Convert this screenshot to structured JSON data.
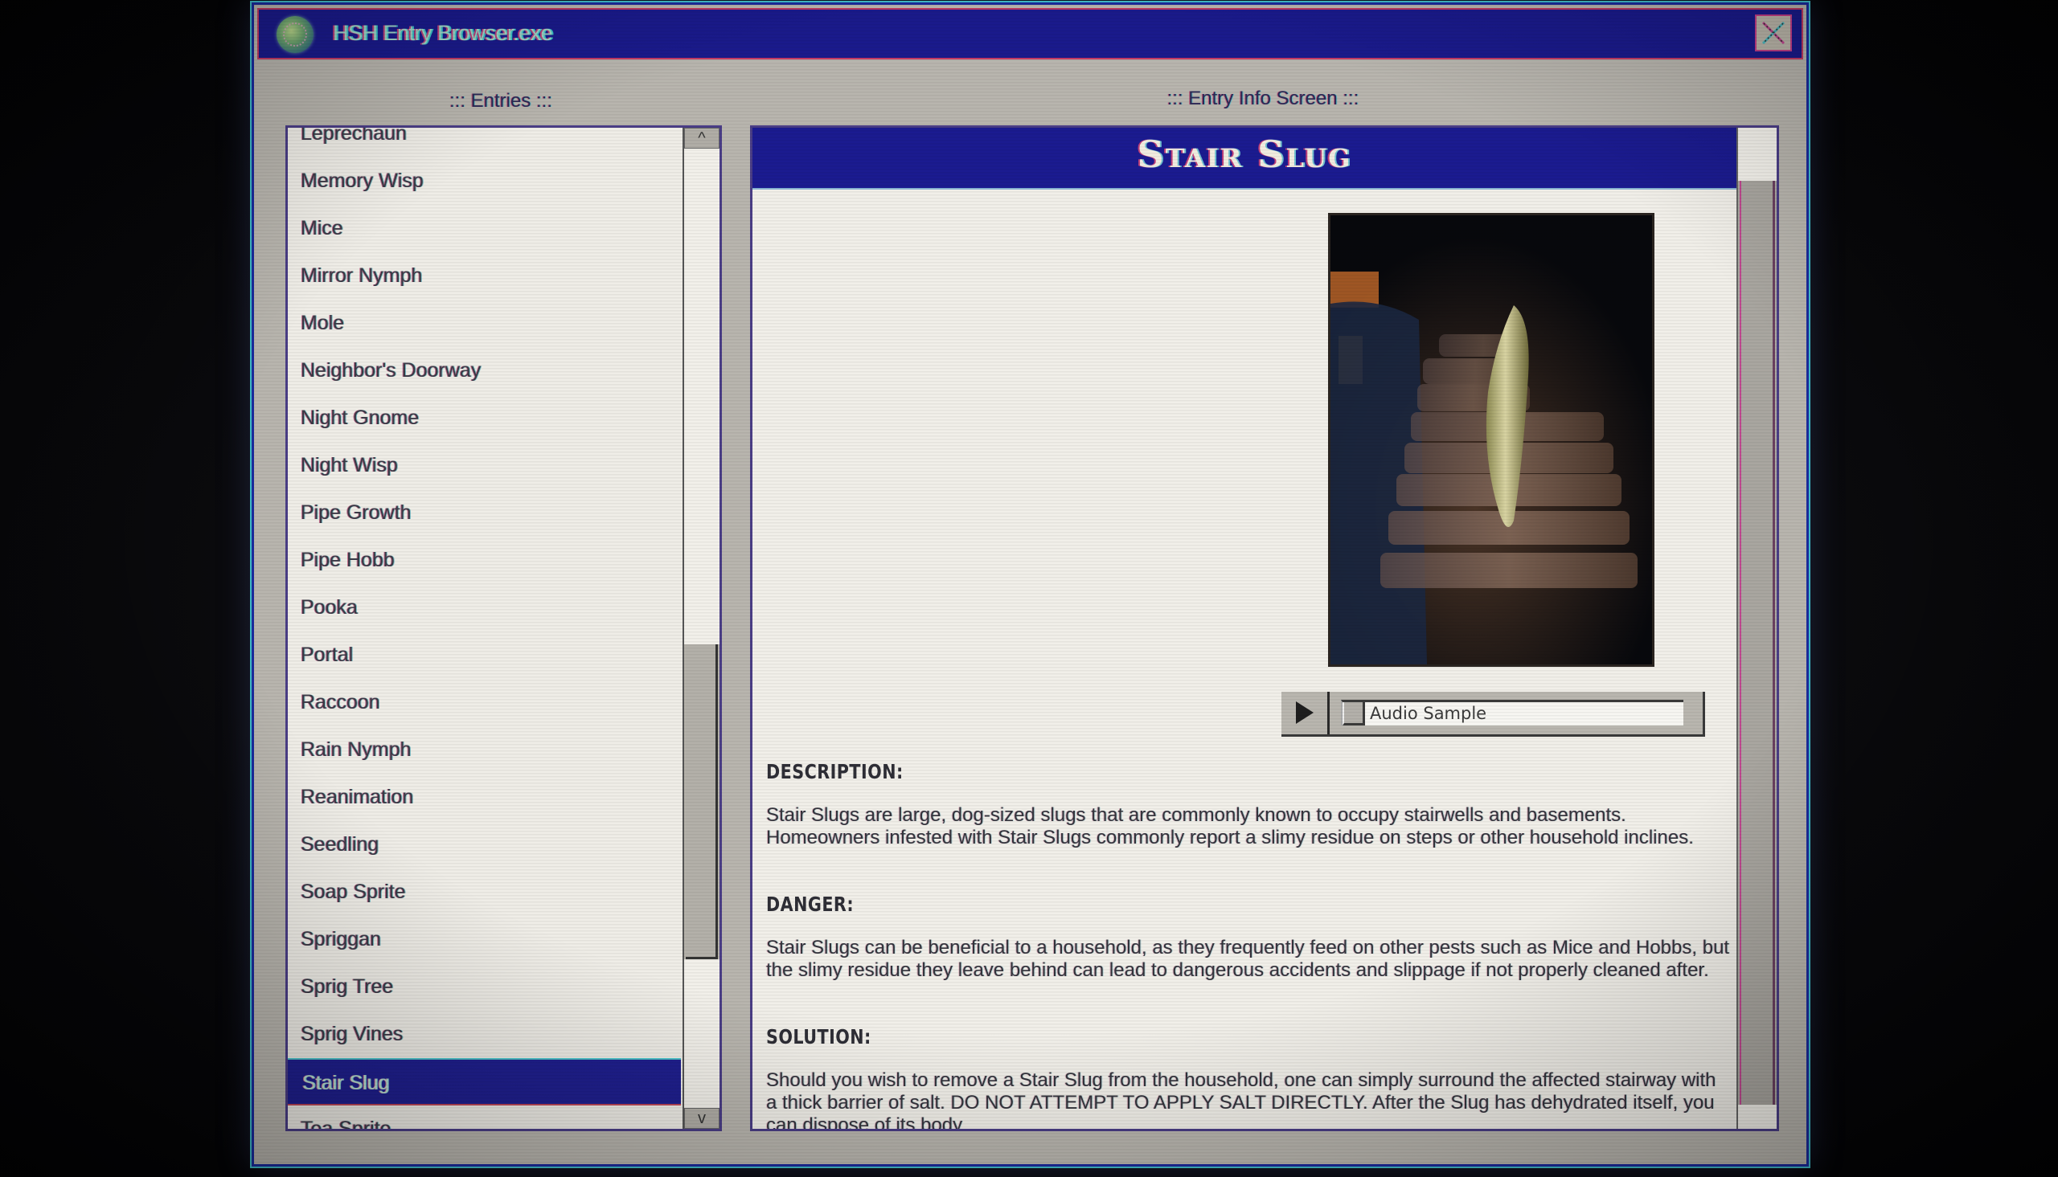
{
  "window": {
    "title": "HSH Entry Browser.exe",
    "icon": "brain-globe-icon",
    "close_icon": "close-x-icon"
  },
  "entries_panel": {
    "label": "::: Entries :::",
    "items": [
      "Leprechaun",
      "Memory Wisp",
      "Mice",
      "Mirror Nymph",
      "Mole",
      "Neighbor's Doorway",
      "Night Gnome",
      "Night Wisp",
      "Pipe Growth",
      "Pipe Hobb",
      "Pooka",
      "Portal",
      "Raccoon",
      "Rain Nymph",
      "Reanimation",
      "Seedling",
      "Soap Sprite",
      "Spriggan",
      "Sprig Tree",
      "Sprig Vines",
      "Stair Slug",
      "Tea Sprite"
    ],
    "selected": "Stair Slug",
    "scroll_up_label": "^",
    "scroll_down_label": "v",
    "scroll_position": 0.55
  },
  "info_panel": {
    "label": "::: Entry Info Screen :::",
    "title": "Stair Slug",
    "image_alt": "Photo of a stair slug on a staircase",
    "audio": {
      "label": "Audio Sample",
      "play_icon": "play-icon",
      "progress": 0
    },
    "sections": [
      {
        "heading": "DESCRIPTION:",
        "body": "Stair Slugs are large, dog-sized slugs that are commonly known to occupy stairwells and basements. Homeowners infested with Stair Slugs commonly report a slimy residue on steps or other household inclines."
      },
      {
        "heading": "DANGER:",
        "body": "Stair Slugs can be beneficial to a household, as they frequently feed on other pests such as Mice and Hobbs, but the slimy residue they leave behind can lead to dangerous accidents and slippage if not properly cleaned after."
      },
      {
        "heading": "SOLUTION:",
        "body": "Should you wish to remove a Stair Slug from the household, one can simply surround the affected stairway with a thick barrier of salt. DO NOT ATTEMPT TO APPLY SALT DIRECTLY. After the Slug has dehydrated itself, you can dispose of its body."
      }
    ],
    "scroll_position": 0.0
  },
  "colors": {
    "titlebar": "#1a1a8c",
    "selection": "#1f1f8e",
    "window_bg": "#b8b5ae",
    "panel_bg": "#f1efe9"
  }
}
